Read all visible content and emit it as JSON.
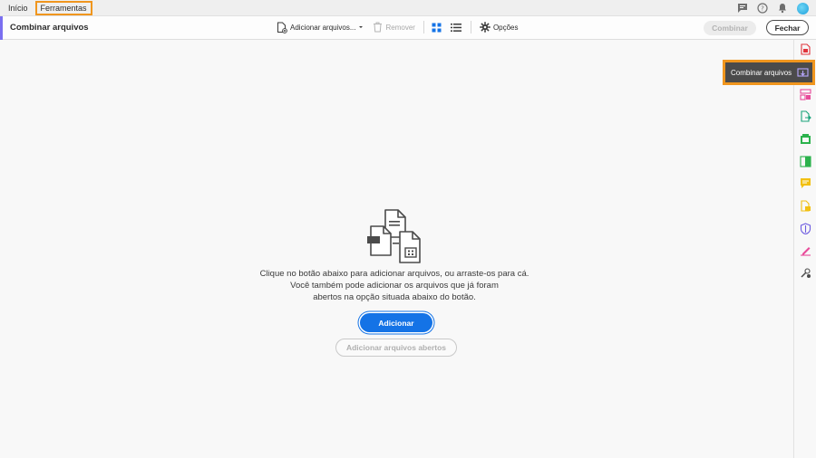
{
  "menubar": {
    "items": [
      "Início",
      "Ferramentas"
    ],
    "active_index": 1
  },
  "toolbar": {
    "tool_title": "Combinar arquivos",
    "add_files_label": "Adicionar arquivos...",
    "remove_label": "Remover",
    "options_label": "Opções",
    "combine_label": "Combinar",
    "close_label": "Fechar"
  },
  "tooltip": {
    "label": "Combinar arquivos"
  },
  "main": {
    "message_line1": "Clique no botão abaixo para adicionar arquivos, ou arraste-os para cá.",
    "message_line2": "Você também pode adicionar os arquivos que já foram",
    "message_line3": "abertos na opção situada abaixo do botão.",
    "add_button": "Adicionar",
    "add_open_button": "Adicionar arquivos abertos"
  },
  "colors": {
    "accent": "#7a6ff0",
    "primary_button": "#1473e6",
    "highlight": "#f0961e"
  },
  "rail_icons": [
    "create-pdf-icon",
    "combine-files-icon",
    "organize-pages-icon",
    "export-pdf-icon",
    "edit-pdf-icon",
    "compress-pdf-icon",
    "comment-icon",
    "scan-ocr-icon",
    "protect-icon",
    "fill-sign-icon",
    "more-tools-icon"
  ]
}
